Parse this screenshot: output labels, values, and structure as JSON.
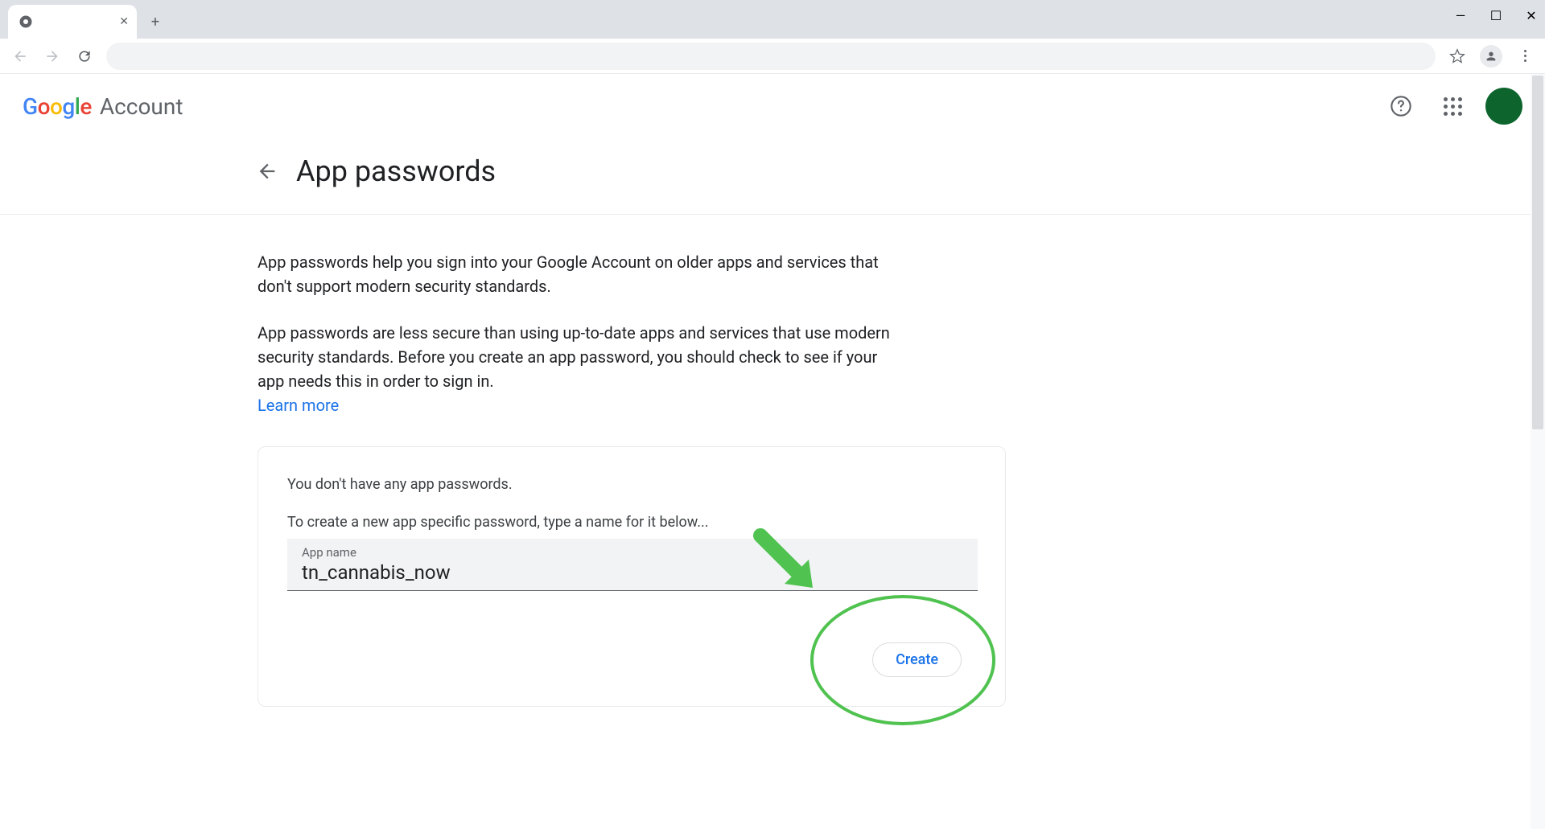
{
  "header": {
    "logo_brand": "Google",
    "account_label": "Account"
  },
  "page": {
    "title": "App passwords",
    "description1": "App passwords help you sign into your Google Account on older apps and services that don't support modern security standards.",
    "description2": "App passwords are less secure than using up-to-date apps and services that use modern security standards. Before you create an app password, you should check to see if your app needs this in order to sign in.",
    "learn_more": "Learn more"
  },
  "card": {
    "empty_msg": "You don't have any app passwords.",
    "instruction": "To create a new app specific password, type a name for it below...",
    "input_label": "App name",
    "input_value": "tn_cannabis_now",
    "create_label": "Create"
  },
  "colors": {
    "annotation_green": "#4fc24f",
    "avatar_green": "#0d652d",
    "link_blue": "#1a73e8"
  }
}
